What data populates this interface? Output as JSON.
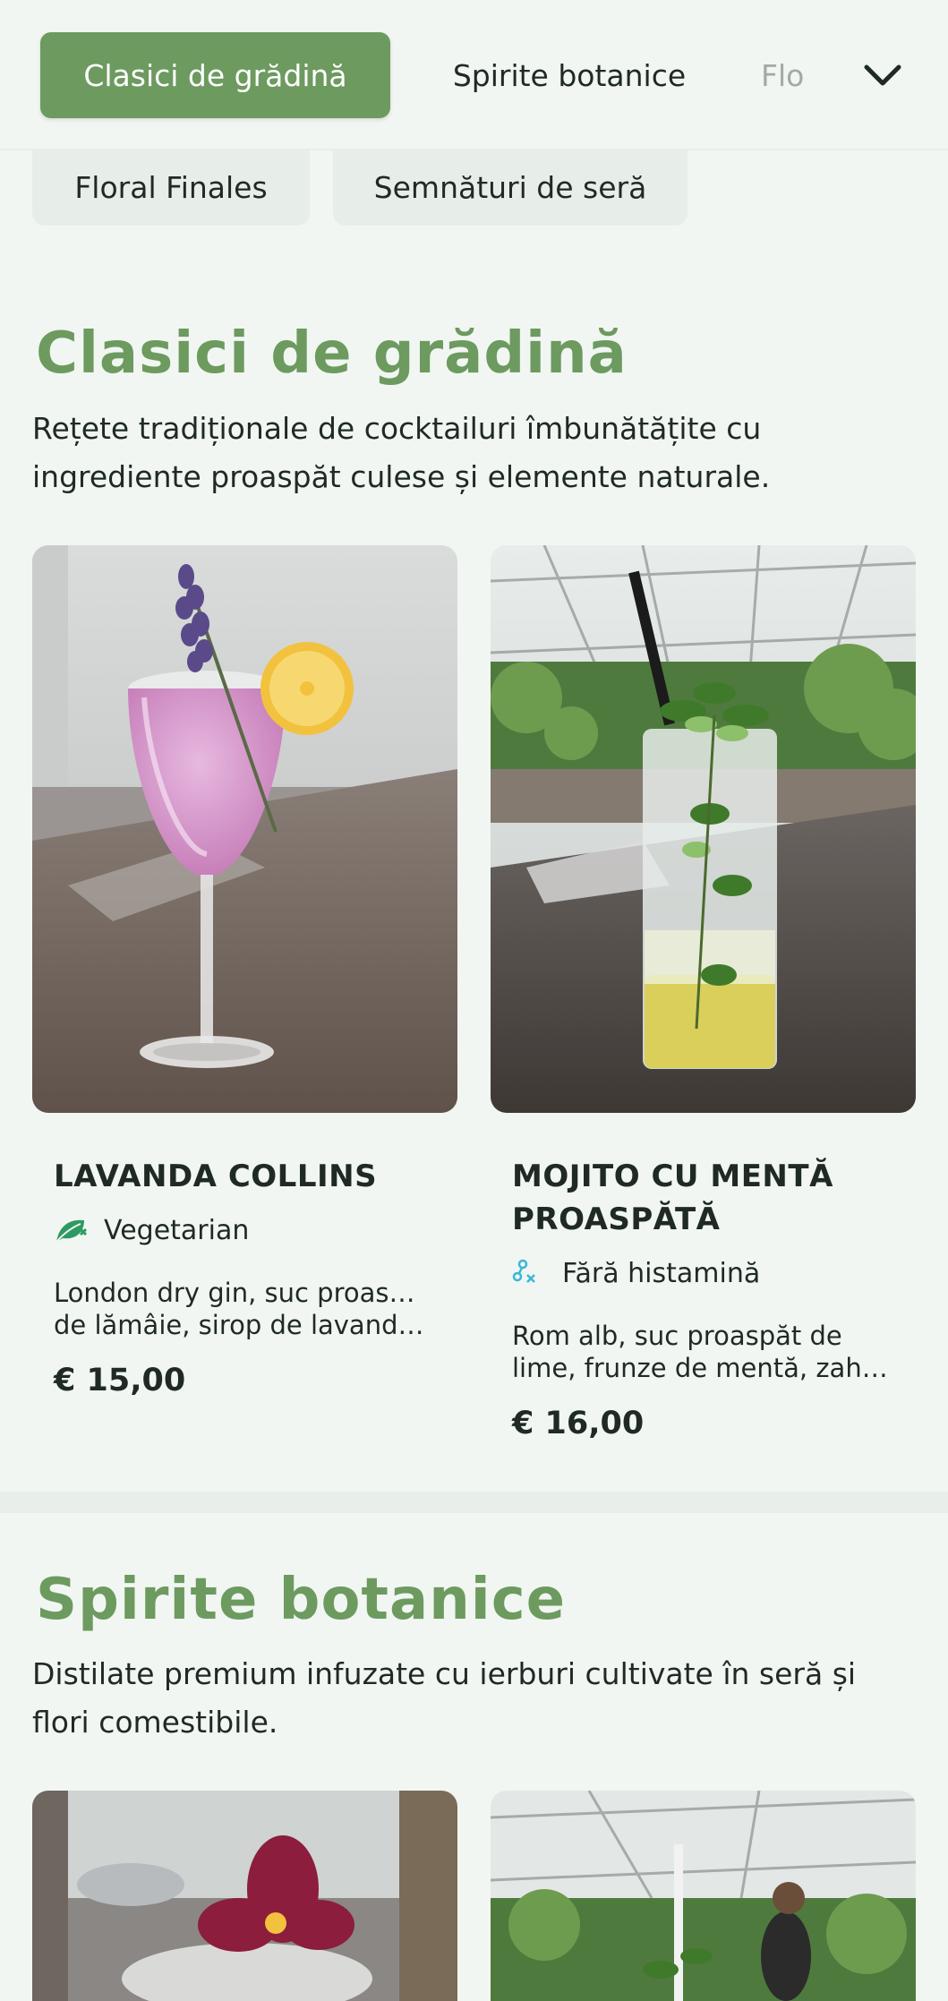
{
  "nav": {
    "tabs": [
      {
        "label": "Clasici de grădină",
        "active": true
      },
      {
        "label": "Spirite botanice",
        "active": false
      },
      {
        "label": "Flo",
        "active": false
      }
    ],
    "chips": [
      {
        "label": "Floral Finales"
      },
      {
        "label": "Semnături de seră"
      }
    ],
    "more_icon": "chevron-down-icon"
  },
  "colors": {
    "accent": "#6d9a5f",
    "background": "#f1f6f2",
    "text": "#1f2a23",
    "vegetarian_icon": "#2e9a63",
    "histamine_icon": "#3ab7d8"
  },
  "sections": [
    {
      "title": "Clasici de grădină",
      "description": "Rețete tradiționale de cocktailuri îmbunătățite cu ingrediente proaspăt culese și elemente naturale.",
      "items": [
        {
          "name": "LAVANDA COLLINS",
          "diet_label": "Vegetarian",
          "diet_icon": "vegetarian-leaf-icon",
          "description_line1": "London dry gin, suc proaspăt",
          "description_line2": "de lămâie, sirop de lavandă ...",
          "price": "€ 15,00",
          "image": "pink-lavender-cocktail-photo"
        },
        {
          "name": "MOJITO CU MENTĂ PROASPĂTĂ",
          "diet_label": "Fără histamină",
          "diet_icon": "histamine-free-icon",
          "description_line1": "Rom alb, suc proaspăt de",
          "description_line2": "lime, frunze de mentă, zahă...",
          "price": "€ 16,00",
          "image": "mint-mojito-photo"
        }
      ]
    },
    {
      "title": "Spirite botanice",
      "description": "Distilate premium infuzate cu ierburi cultivate în seră și flori comestibile.",
      "items": [
        {
          "image": "flower-garnished-cocktail-photo"
        },
        {
          "image": "greenhouse-herb-cocktail-photo"
        }
      ]
    }
  ]
}
